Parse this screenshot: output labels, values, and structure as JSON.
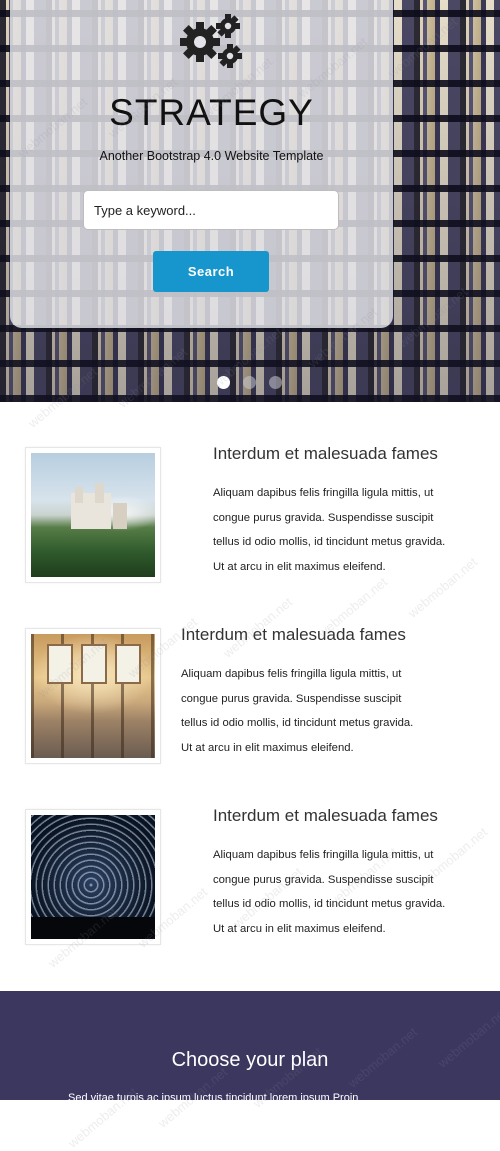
{
  "hero": {
    "logo_icon": "gears-icon",
    "title": "STRATEGY",
    "subtitle": "Another Bootstrap 4.0 Website Template",
    "search_placeholder": "Type a keyword...",
    "search_button": "Search",
    "carousel": {
      "count": 3,
      "active": 1
    }
  },
  "features": [
    {
      "title": "Interdum et malesuada fames",
      "lines": [
        "Aliquam dapibus felis fringilla ligula mittis, ut",
        "congue purus gravida. Suspendisse suscipit",
        "tellus id odio mollis, id tincidunt metus gravida.",
        "Ut at arcu in elit maximus eleifend."
      ],
      "image": "castle-photo"
    },
    {
      "title": "Interdum et malesuada fames",
      "lines": [
        "Aliquam dapibus felis fringilla ligula mittis, ut",
        "congue purus gravida. Suspendisse suscipit",
        "tellus id odio mollis, id tincidunt metus gravida.",
        "Ut at arcu in elit maximus eleifend."
      ],
      "image": "station-photo"
    },
    {
      "title": "Interdum et malesuada fames",
      "lines": [
        "Aliquam dapibus felis fringilla ligula mittis, ut",
        "congue purus gravida. Suspendisse suscipit",
        "tellus id odio mollis, id tincidunt metus gravida.",
        "Ut at arcu in elit maximus eleifend."
      ],
      "image": "star-trails-photo"
    }
  ],
  "plan": {
    "title": "Choose your plan",
    "text": "Sed vitae turpis ac ipsum luctus tincidunt lorem ipsum Proin"
  },
  "watermark": "webmoban.net",
  "colors": {
    "accent": "#1696cc",
    "plan_bg": "#3c375f"
  }
}
